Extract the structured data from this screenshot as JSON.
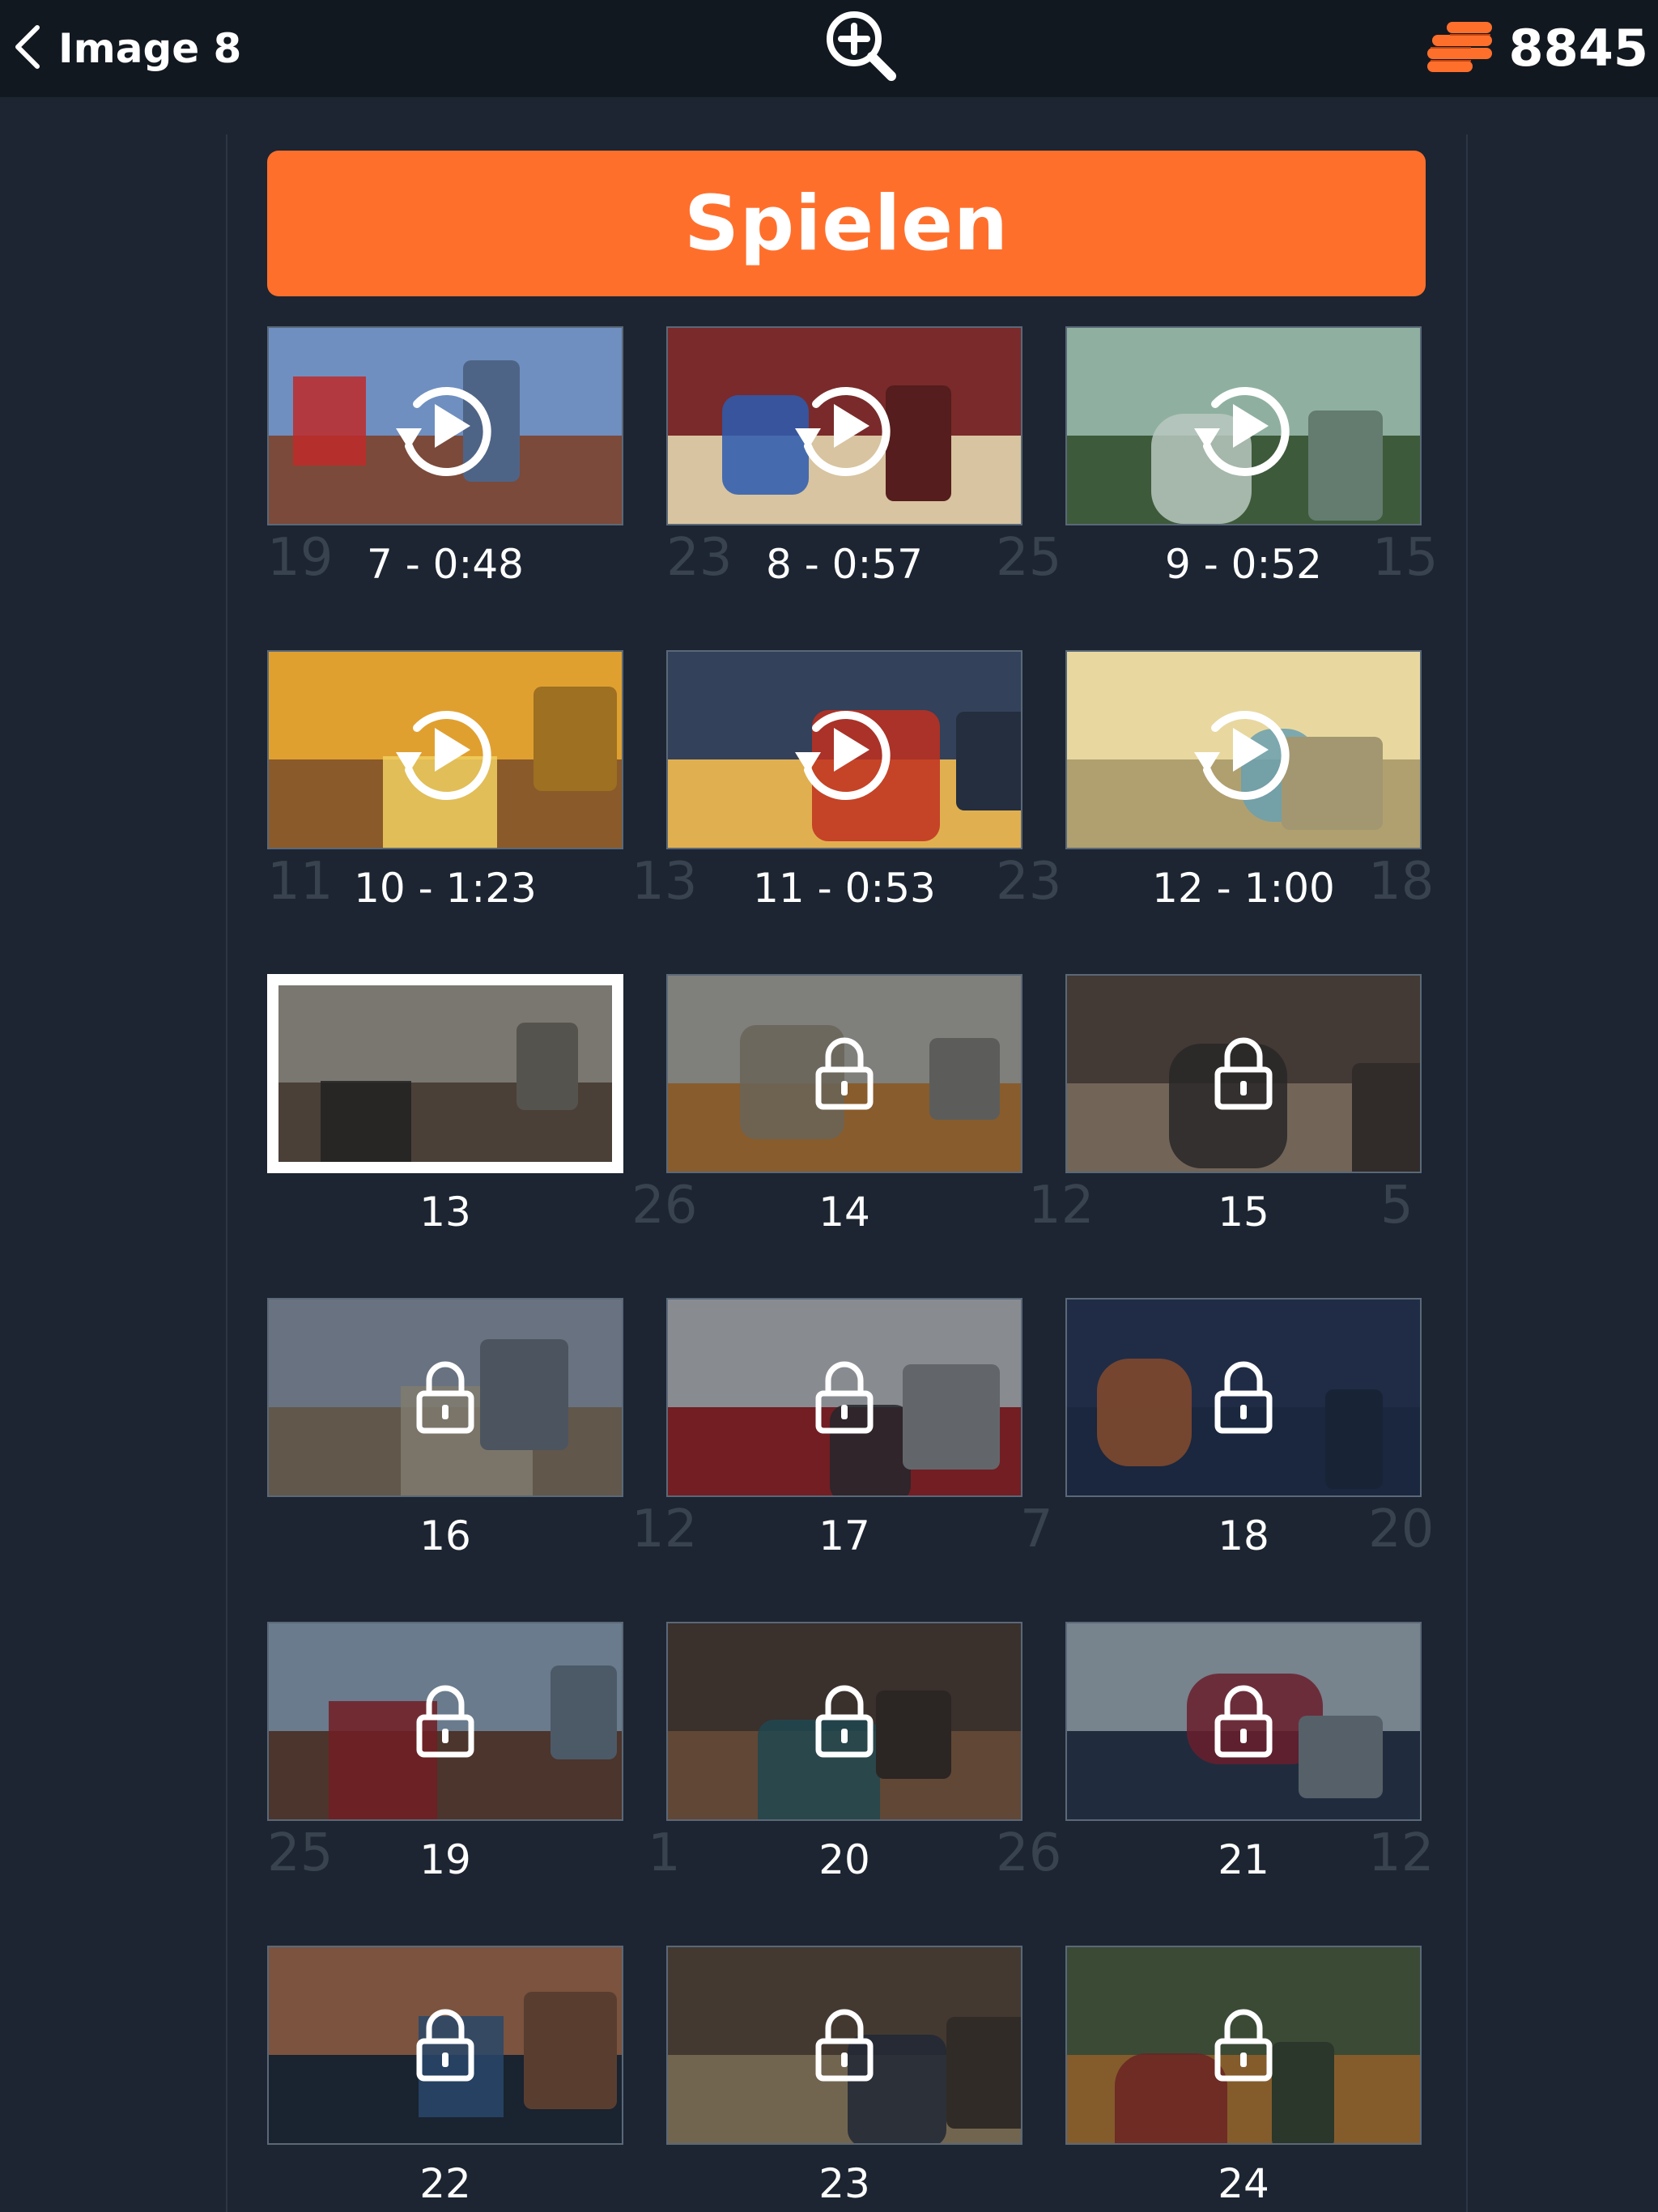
{
  "header": {
    "title": "Image 8",
    "coins": "8845"
  },
  "play_button": {
    "label": "Spielen"
  },
  "colors": {
    "accent": "#ff6f2c",
    "background": "#1c2531",
    "topbar": "#121820",
    "coin": "#ff6f2c"
  },
  "tiles": [
    {
      "label": "7 - 0:48",
      "state": "replay"
    },
    {
      "label": "8 - 0:57",
      "state": "replay"
    },
    {
      "label": "9 - 0:52",
      "state": "replay"
    },
    {
      "label": "10 - 1:23",
      "state": "replay"
    },
    {
      "label": "11 - 0:53",
      "state": "replay"
    },
    {
      "label": "12 - 1:00",
      "state": "replay"
    },
    {
      "label": "13",
      "state": "current"
    },
    {
      "label": "14",
      "state": "locked"
    },
    {
      "label": "15",
      "state": "locked"
    },
    {
      "label": "16",
      "state": "locked"
    },
    {
      "label": "17",
      "state": "locked"
    },
    {
      "label": "18",
      "state": "locked"
    },
    {
      "label": "19",
      "state": "locked"
    },
    {
      "label": "20",
      "state": "locked"
    },
    {
      "label": "21",
      "state": "locked"
    },
    {
      "label": "22",
      "state": "locked"
    },
    {
      "label": "23",
      "state": "locked"
    },
    {
      "label": "24",
      "state": "locked"
    }
  ],
  "background_numbers": [
    "19",
    "23",
    "25",
    "15",
    "11",
    "13",
    "23",
    "18",
    "26",
    "12",
    "5",
    "12",
    "7",
    "20",
    "25",
    "1",
    "26",
    "12"
  ]
}
